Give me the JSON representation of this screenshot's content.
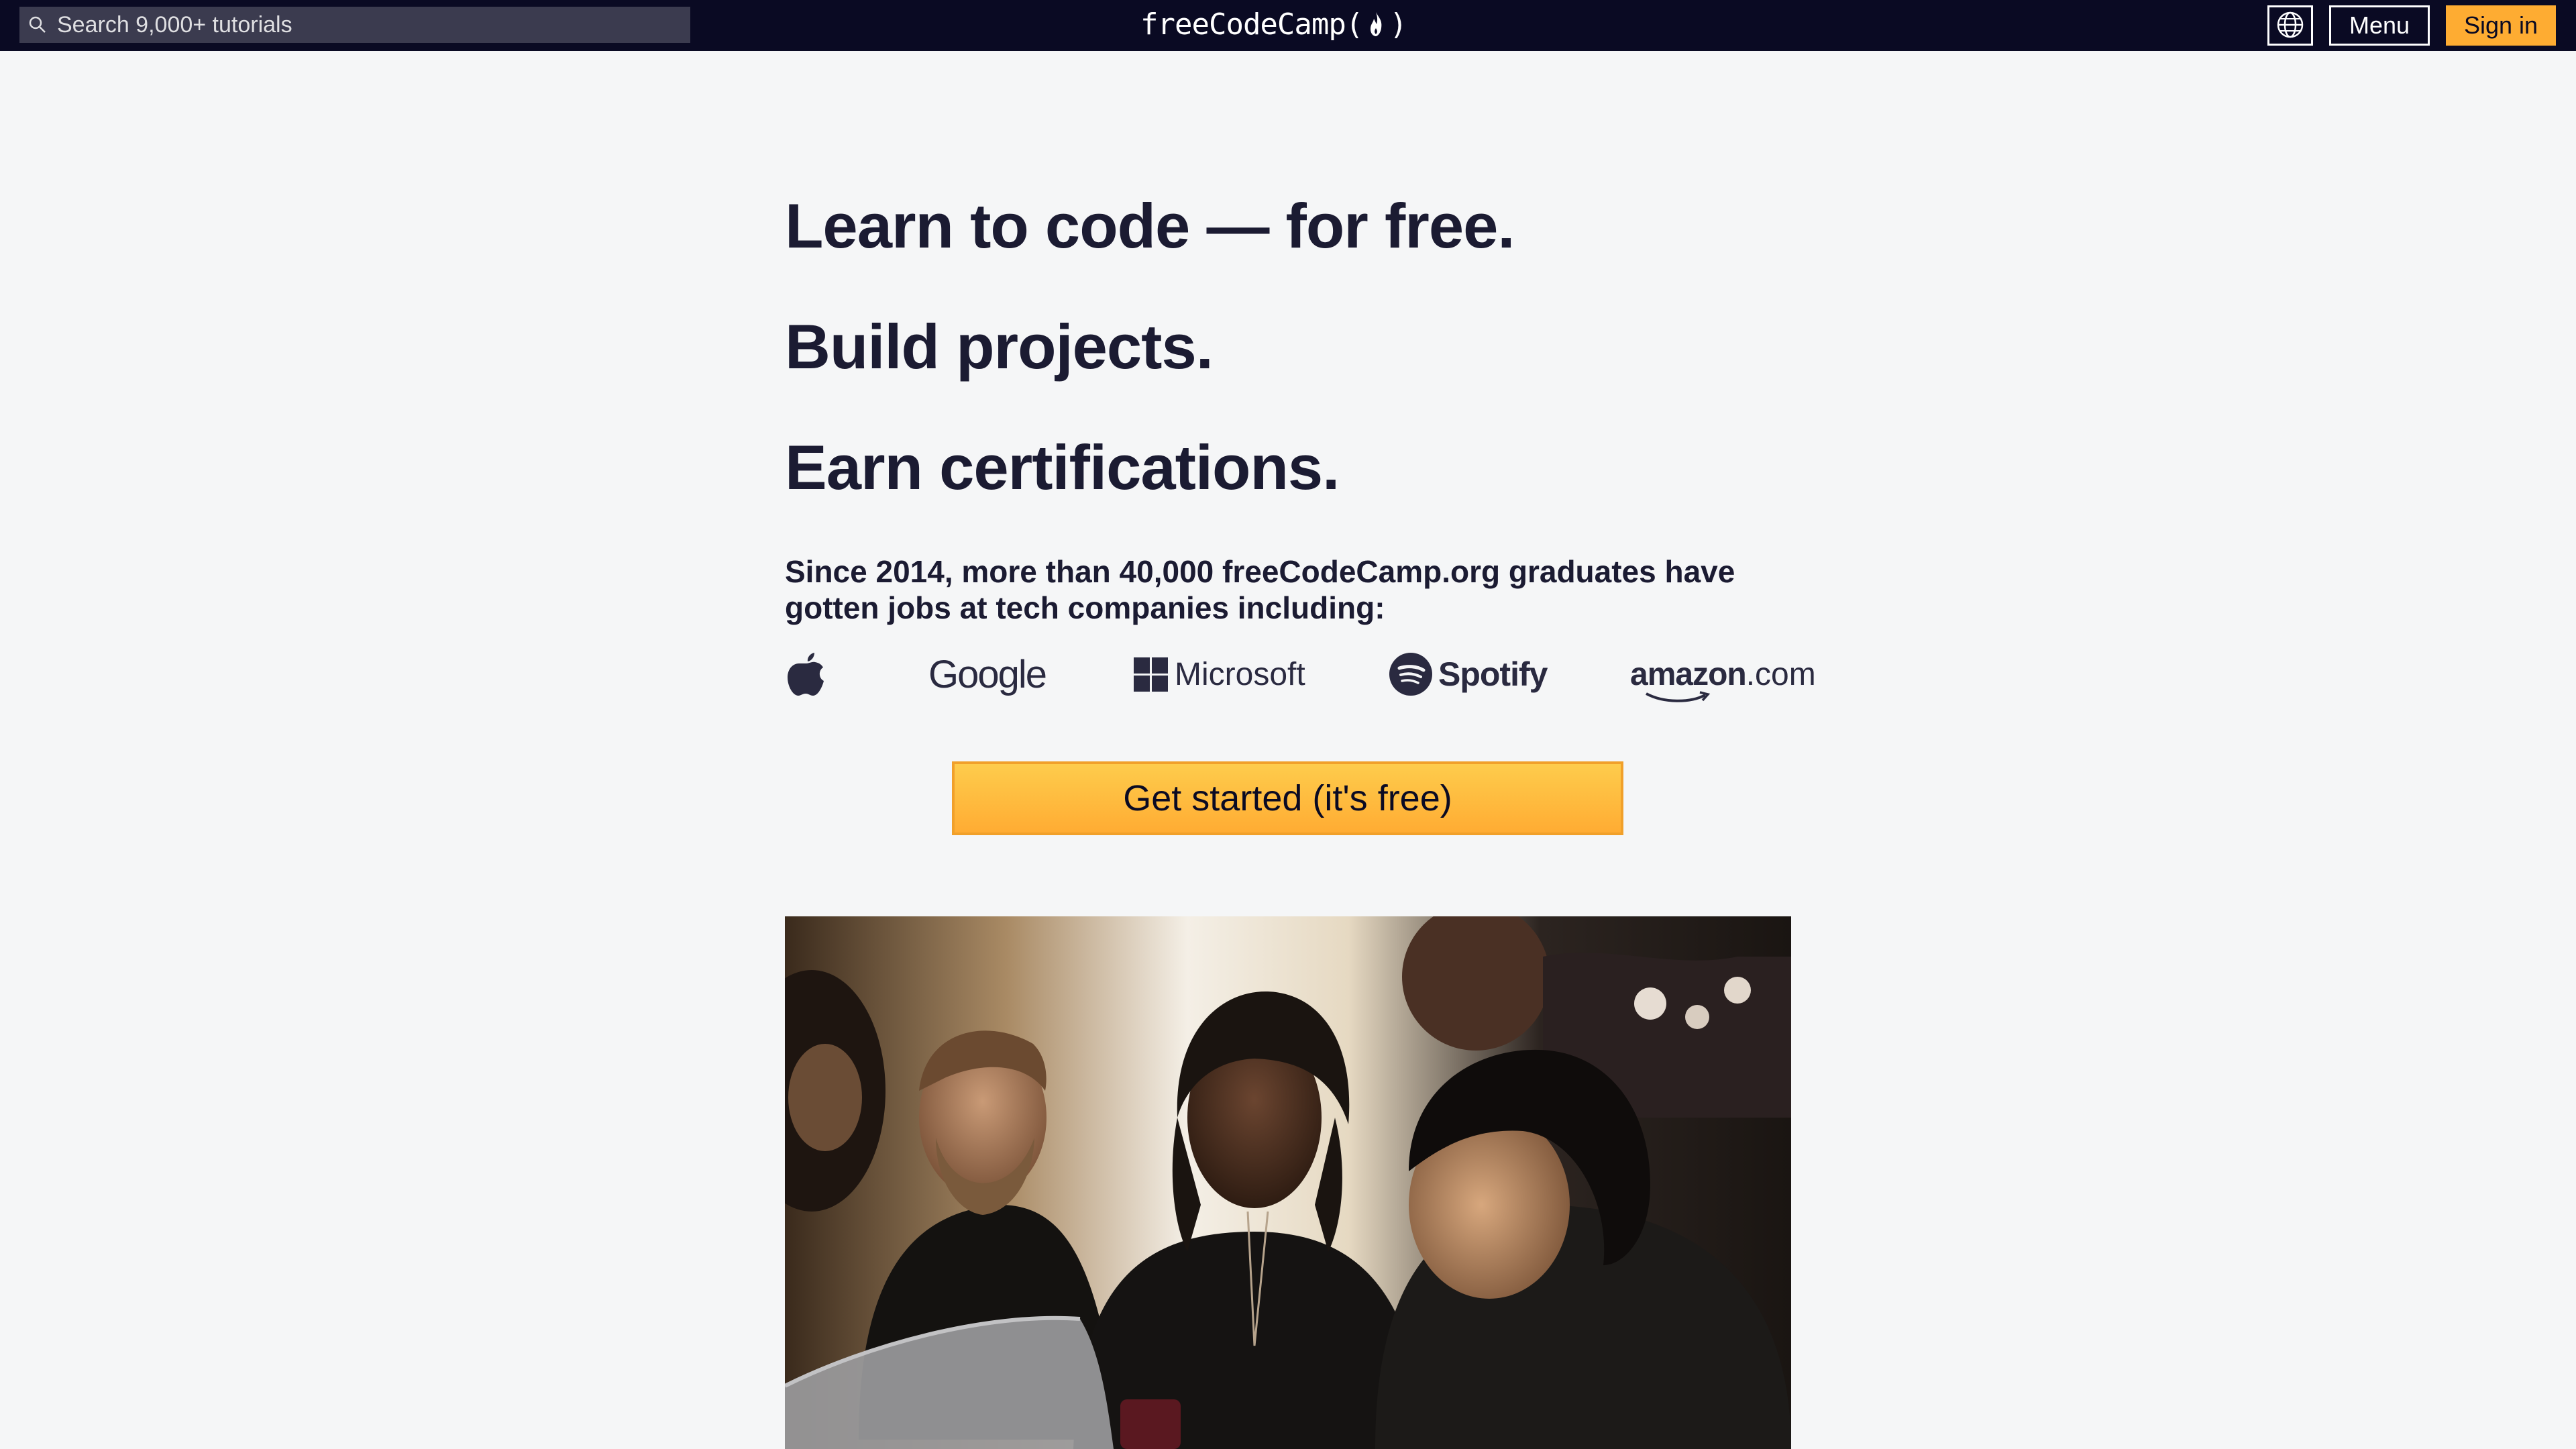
{
  "nav": {
    "search_placeholder": "Search 9,000+ tutorials",
    "logo_prefix": "freeCodeCamp(",
    "logo_suffix": ")",
    "menu_label": "Menu",
    "signin_label": "Sign in"
  },
  "hero": {
    "heading_1": "Learn to code — for free.",
    "heading_2": "Build projects.",
    "heading_3": "Earn certifications.",
    "since_text": "Since 2014, more than 40,000 freeCodeCamp.org graduates have gotten jobs at tech companies including:",
    "cta_label": "Get started (it's free)"
  },
  "companies": {
    "google": "Google",
    "microsoft": "Microsoft",
    "spotify": "Spotify",
    "amazon_main": "amazon",
    "amazon_tld": ".com"
  },
  "colors": {
    "nav_bg": "#0a0a23",
    "page_bg": "#f5f6f7",
    "accent": "#feac32",
    "search_bg": "#3b3b4f"
  },
  "icons": [
    "search-icon",
    "flame-icon",
    "globe-icon",
    "apple-logo",
    "microsoft-logo",
    "spotify-logo",
    "amazon-smile"
  ]
}
